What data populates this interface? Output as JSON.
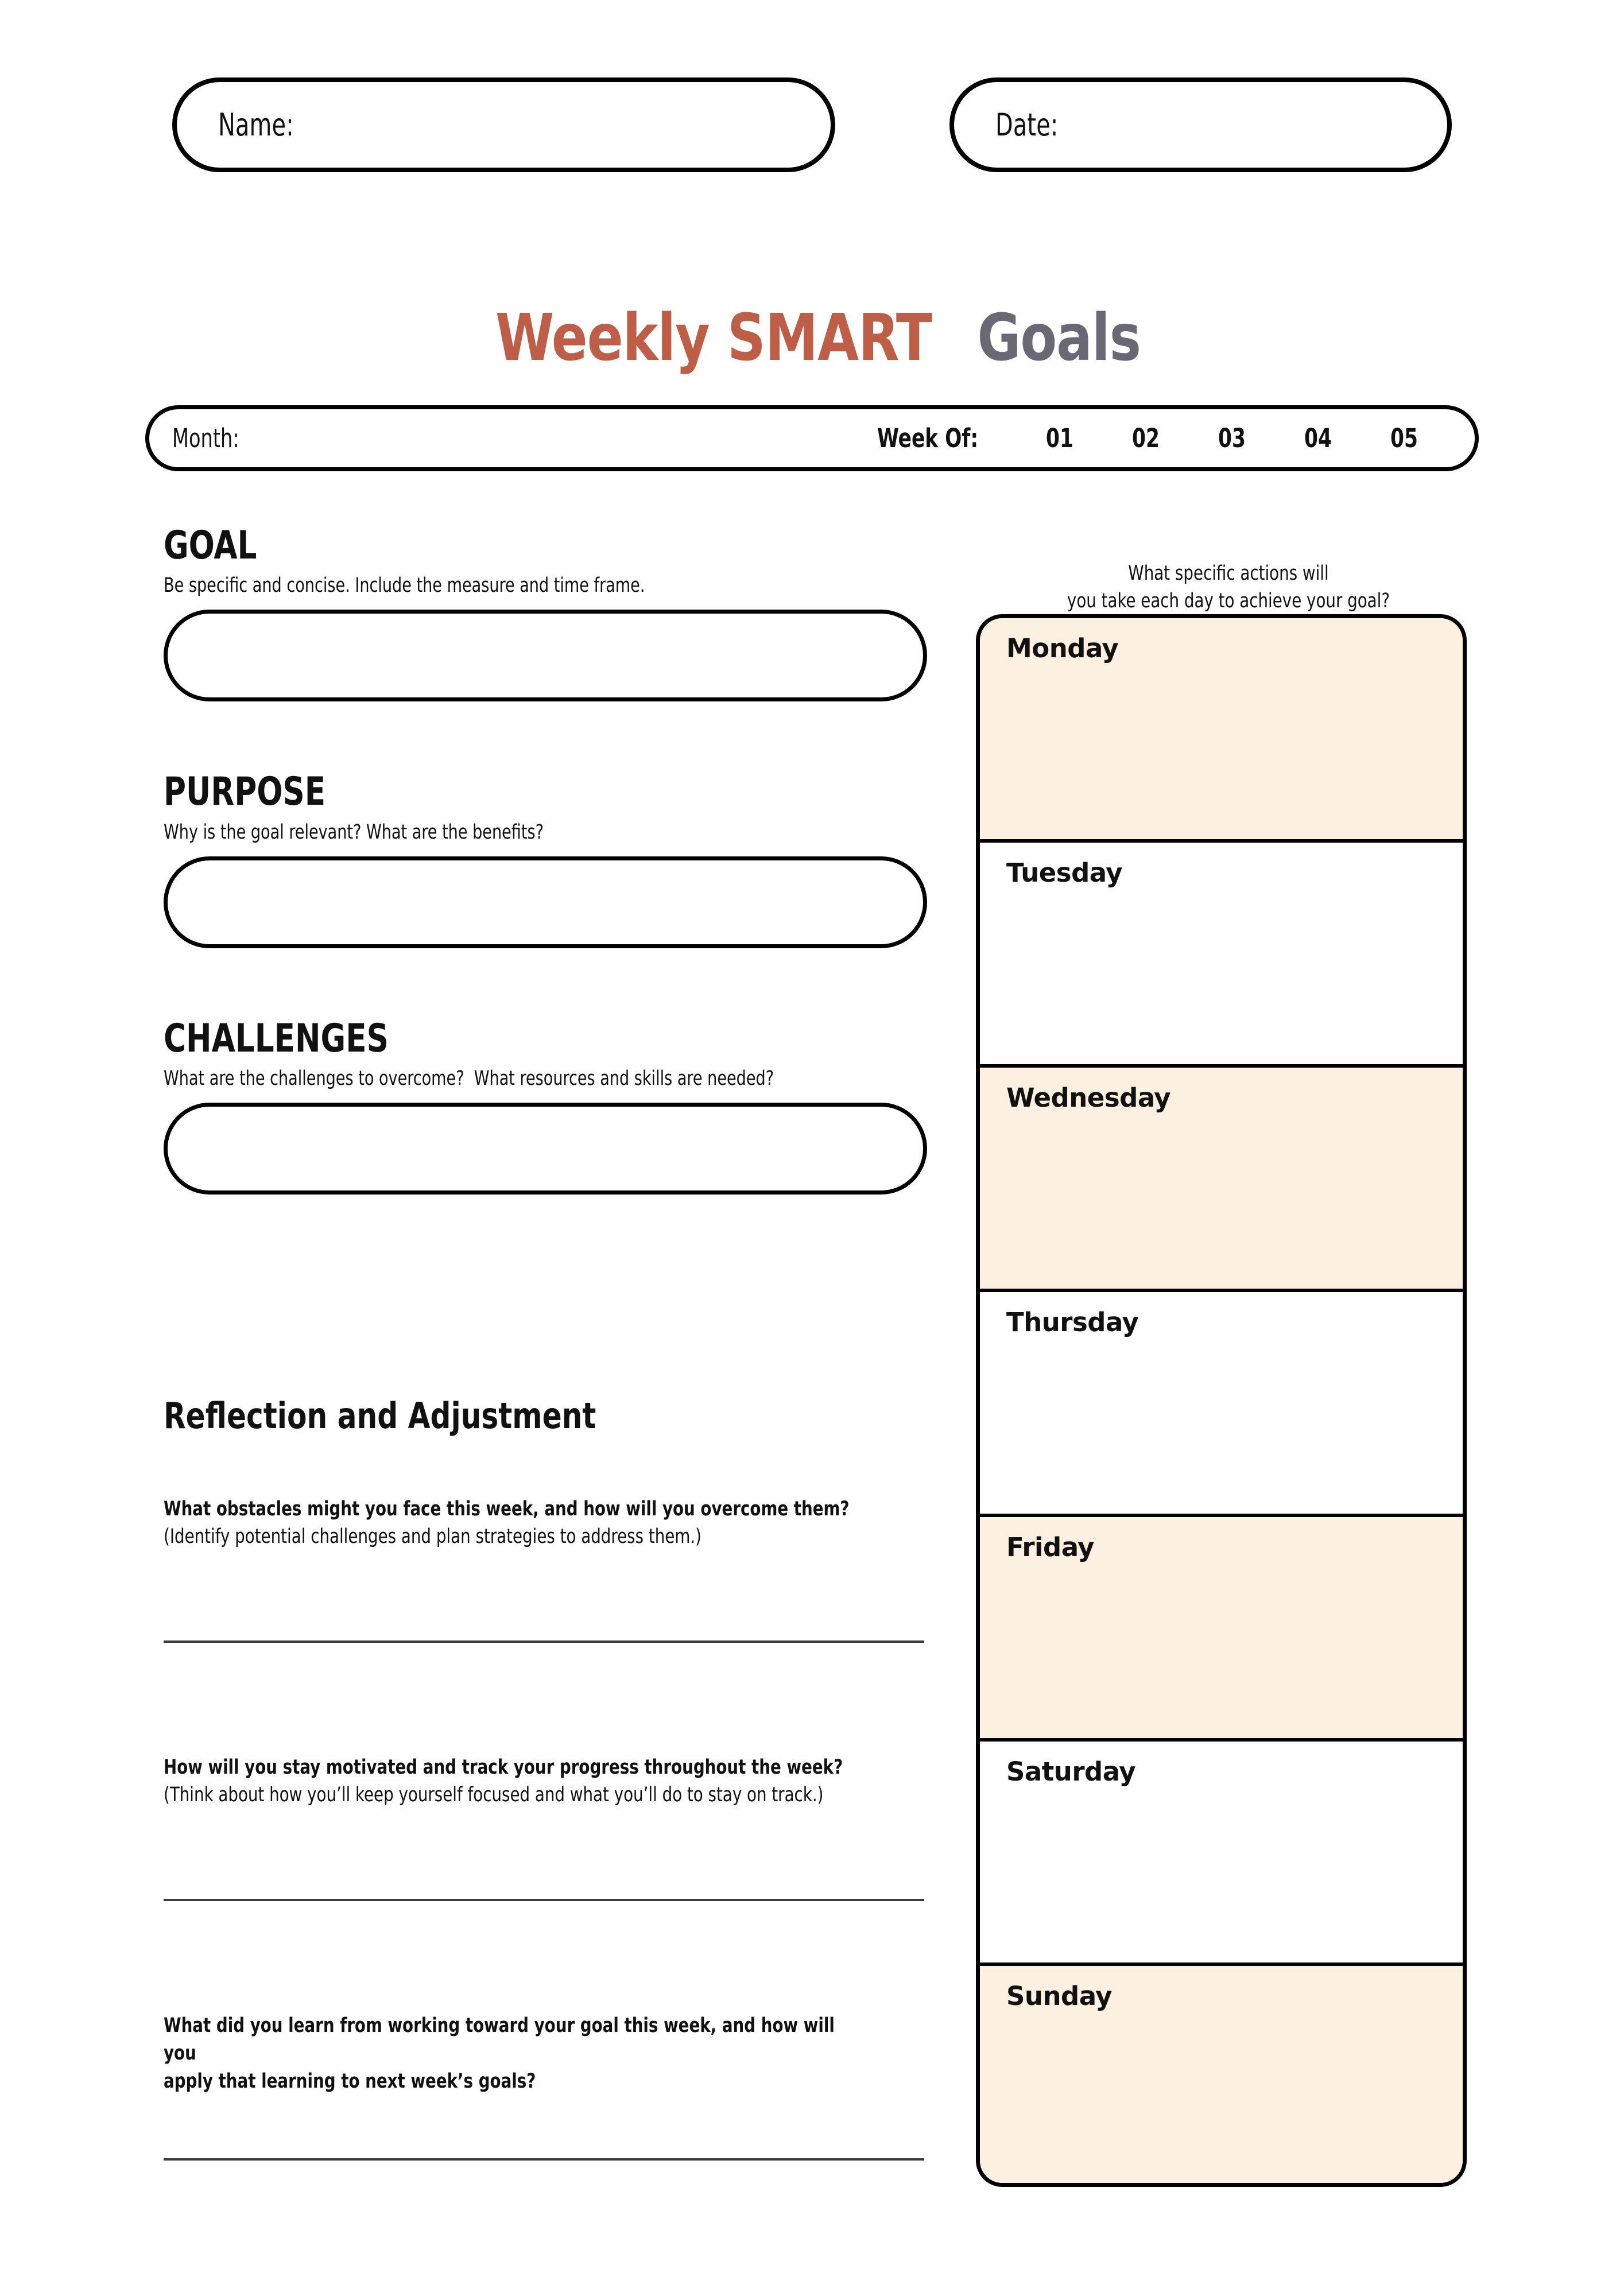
{
  "header": {
    "name_label": "Name:",
    "date_label": "Date:"
  },
  "title": {
    "part_accent": "Weekly SMART",
    "part_muted": "Goals",
    "accent_color": "#BF5E47",
    "muted_color": "#6B6875"
  },
  "month_bar": {
    "month_label": "Month:",
    "week_of_label": "Week Of:",
    "weeks": [
      "01",
      "02",
      "03",
      "04",
      "05"
    ]
  },
  "sections": [
    {
      "heading": "GOAL",
      "subtitle": "Be specific and concise. Include the measure and time frame."
    },
    {
      "heading": "PURPOSE",
      "subtitle": "Why is the goal relevant? What are the benefits?"
    },
    {
      "heading": "CHALLENGES",
      "subtitle": "What are the challenges to overcome?  What resources and skills are needed?"
    }
  ],
  "reflection": {
    "title": "Reflection and Adjustment",
    "questions": [
      {
        "main": "What obstacles might you face this week, and how will you overcome them?",
        "sub": "(Identify potential challenges and plan strategies to address them.)"
      },
      {
        "main": "How will you stay motivated and track your progress throughout the week?",
        "sub": "(Think about how you’ll keep yourself focused and what you’ll do to stay on track.)"
      },
      {
        "main_line1": "What did you learn from working toward your goal this week, and how will you",
        "main_line2": "apply that learning to next week’s goals?",
        "sub": ""
      }
    ]
  },
  "days_panel": {
    "prompt_line1": "What specific actions will",
    "prompt_line2": "you take each day to achieve your goal?",
    "tint_color": "#FCF1E0",
    "days": [
      {
        "label": "Monday",
        "tint": true
      },
      {
        "label": "Tuesday",
        "tint": false
      },
      {
        "label": "Wednesday",
        "tint": true
      },
      {
        "label": "Thursday",
        "tint": false
      },
      {
        "label": "Friday",
        "tint": true
      },
      {
        "label": "Saturday",
        "tint": false
      },
      {
        "label": "Sunday",
        "tint": true
      }
    ]
  }
}
